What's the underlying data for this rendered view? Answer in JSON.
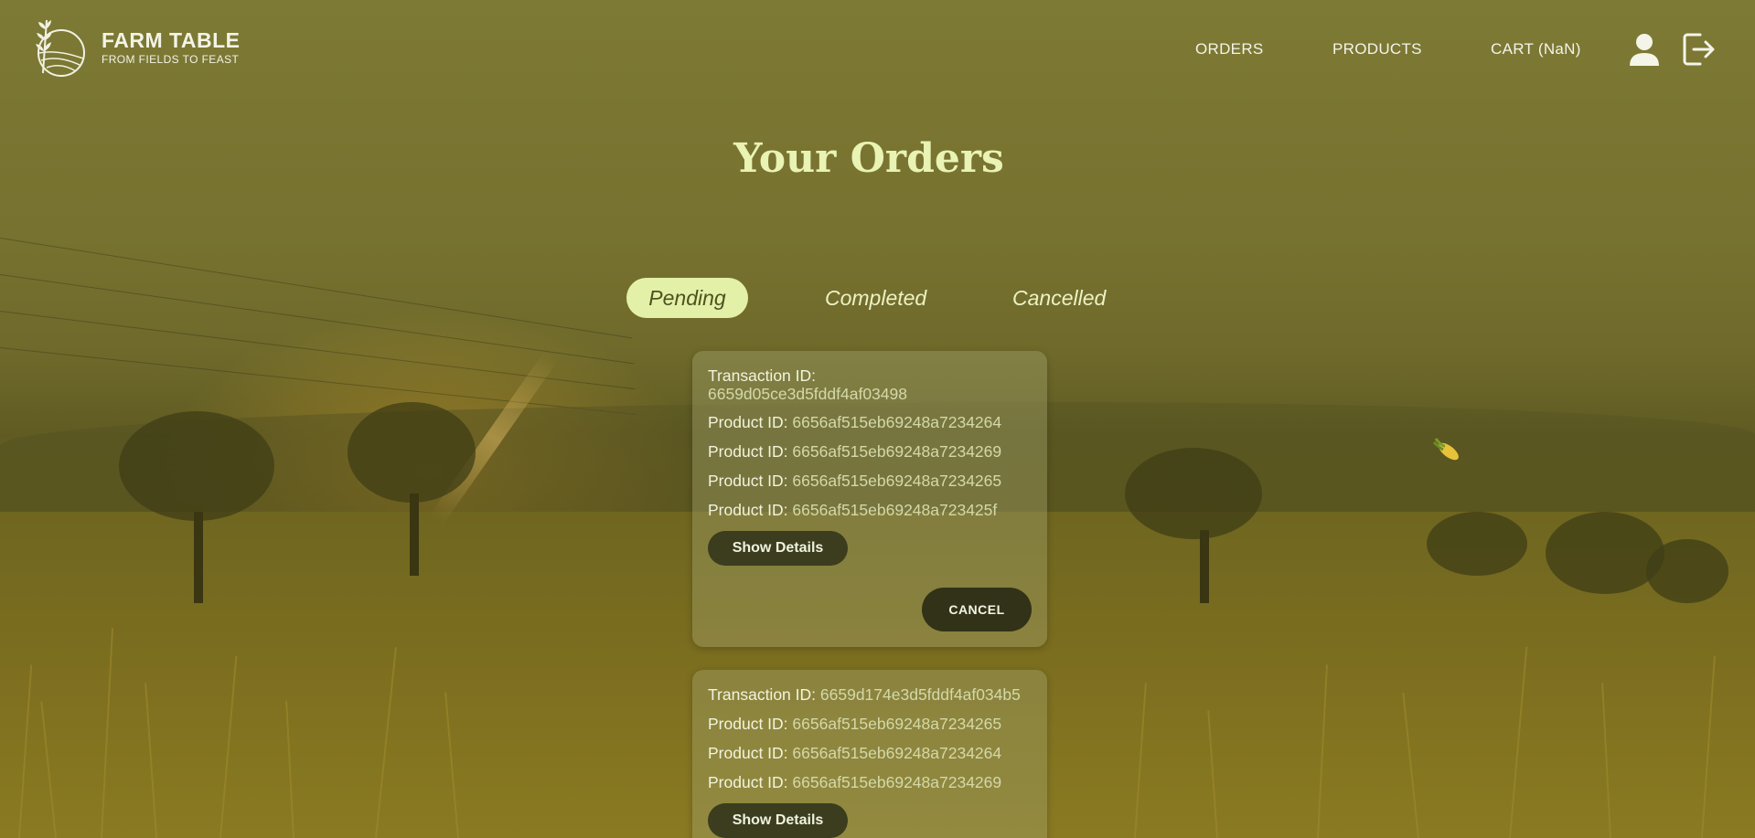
{
  "brand": {
    "title": "FARM TABLE",
    "tagline": "FROM FIELDS TO FEAST"
  },
  "nav": {
    "orders": "ORDERS",
    "products": "PRODUCTS",
    "cart": "CART (NaN)",
    "user_icon": "user-icon",
    "logout_icon": "logout-icon"
  },
  "page_title": "Your Orders",
  "tabs": [
    {
      "label": "Pending",
      "active": true
    },
    {
      "label": "Completed",
      "active": false
    },
    {
      "label": "Cancelled",
      "active": false
    }
  ],
  "orders": [
    {
      "transaction_label": "Transaction ID:",
      "transaction_id": "6659d05ce3d5fddf4af03498",
      "products": [
        {
          "label": "Product ID:",
          "id": "6656af515eb69248a7234264"
        },
        {
          "label": "Product ID:",
          "id": "6656af515eb69248a7234269"
        },
        {
          "label": "Product ID:",
          "id": "6656af515eb69248a7234265"
        },
        {
          "label": "Product ID:",
          "id": "6656af515eb69248a723425f"
        }
      ],
      "details_label": "Show Details",
      "cancel_label": "CANCEL"
    },
    {
      "transaction_label": "Transaction ID:",
      "transaction_id": "6659d174e3d5fddf4af034b5",
      "products": [
        {
          "label": "Product ID:",
          "id": "6656af515eb69248a7234265"
        },
        {
          "label": "Product ID:",
          "id": "6656af515eb69248a7234264"
        },
        {
          "label": "Product ID:",
          "id": "6656af515eb69248a7234269"
        }
      ],
      "details_label": "Show Details"
    }
  ],
  "colors": {
    "overlay": "#7d7a35",
    "accent": "#e3f1a8",
    "title": "#e9f3b3",
    "button_dark": "#313217"
  }
}
